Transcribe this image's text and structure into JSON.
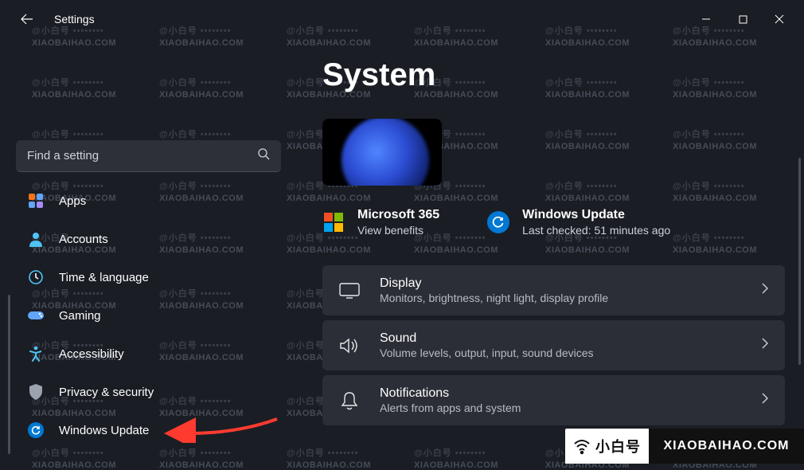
{
  "app": {
    "title": "Settings"
  },
  "search": {
    "placeholder": "Find a setting"
  },
  "sidebar": {
    "items": [
      {
        "label": "Apps",
        "name": "sidebar-item-apps"
      },
      {
        "label": "Accounts",
        "name": "sidebar-item-accounts"
      },
      {
        "label": "Time & language",
        "name": "sidebar-item-time-language"
      },
      {
        "label": "Gaming",
        "name": "sidebar-item-gaming"
      },
      {
        "label": "Accessibility",
        "name": "sidebar-item-accessibility"
      },
      {
        "label": "Privacy & security",
        "name": "sidebar-item-privacy-security"
      },
      {
        "label": "Windows Update",
        "name": "sidebar-item-windows-update"
      }
    ]
  },
  "page": {
    "title": "System"
  },
  "tiles": {
    "ms365": {
      "title": "Microsoft 365",
      "subtitle": "View benefits"
    },
    "update": {
      "title": "Windows Update",
      "subtitle": "Last checked: 51 minutes ago"
    }
  },
  "cards": [
    {
      "title": "Display",
      "subtitle": "Monitors, brightness, night light, display profile",
      "name": "card-display",
      "icon": "display-icon"
    },
    {
      "title": "Sound",
      "subtitle": "Volume levels, output, input, sound devices",
      "name": "card-sound",
      "icon": "sound-icon"
    },
    {
      "title": "Notifications",
      "subtitle": "Alerts from apps and system",
      "name": "card-notifications",
      "icon": "notifications-icon"
    }
  ],
  "watermark": {
    "domain": "XIAOBAIHAO.COM",
    "cn": "@小白号"
  },
  "badge": {
    "cn": "小白号",
    "domain": "XIAOBAIHAO.COM"
  },
  "colors": {
    "accent": "#0078d4",
    "bg": "#1a1d24",
    "card": "#2b2e36",
    "arrow": "#ff3b30"
  }
}
